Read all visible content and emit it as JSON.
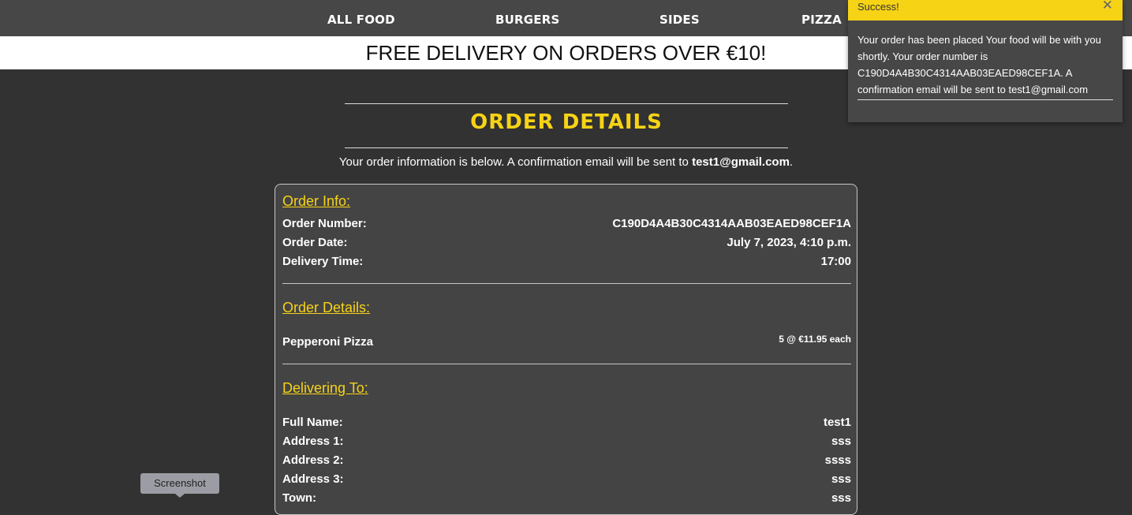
{
  "nav": {
    "items": [
      {
        "label": "ALL FOOD"
      },
      {
        "label": "BURGERS"
      },
      {
        "label": "SIDES"
      },
      {
        "label": "PIZZA"
      }
    ]
  },
  "banner": {
    "text": "FREE DELIVERY ON ORDERS OVER €10!"
  },
  "page": {
    "title": "ORDER DETAILS",
    "intro_prefix": "Your order information is below. A confirmation email will be sent to",
    "intro_email": "test1@gmail.com",
    "intro_suffix": "."
  },
  "order_info": {
    "heading": "Order Info:",
    "rows": [
      {
        "label": "Order Number:",
        "value": "C190D4A4B30C4314AAB03EAED98CEF1A"
      },
      {
        "label": "Order Date:",
        "value": "July 7, 2023, 4:10 p.m."
      },
      {
        "label": "Delivery Time:",
        "value": "17:00"
      }
    ]
  },
  "order_details": {
    "heading": "Order Details:",
    "items": [
      {
        "name": "Pepperoni Pizza",
        "qty_price": "5 @ €11.95 each"
      }
    ]
  },
  "delivering_to": {
    "heading": "Delivering To:",
    "rows": [
      {
        "label": "Full Name:",
        "value": "test1"
      },
      {
        "label": "Address 1:",
        "value": "sss"
      },
      {
        "label": "Address 2:",
        "value": "ssss"
      },
      {
        "label": "Address 3:",
        "value": "sss"
      },
      {
        "label": "Town:",
        "value": "sss"
      }
    ]
  },
  "toast": {
    "title": "Success!",
    "close_symbol": "✕",
    "message": "Your order has been placed Your food will be with you shortly. Your order number is C190D4A4B30C4314AAB03EAED98CEF1A. A confirmation email will be sent to test1@gmail.com"
  },
  "tooltip": {
    "text": "Screenshot"
  },
  "colors": {
    "accent": "#f7d316",
    "background": "#323232",
    "nav": "#474747"
  }
}
